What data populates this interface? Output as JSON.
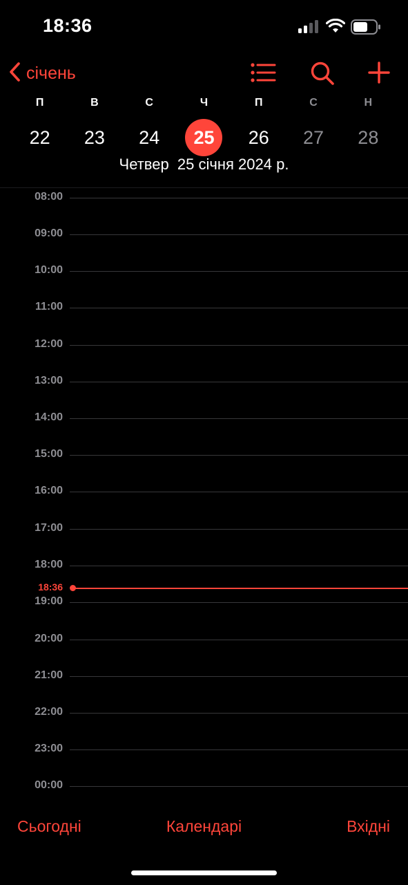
{
  "status_bar": {
    "time": "18:36",
    "icons": [
      "cellular-signal-icon",
      "wifi-icon",
      "battery-icon"
    ]
  },
  "nav": {
    "back_label": "січень",
    "icons": [
      "chevron-left-icon",
      "list-icon",
      "search-icon",
      "plus-icon"
    ],
    "accent_color": "#ff453a"
  },
  "week": {
    "days": [
      {
        "letter": "П",
        "date": "22",
        "weekend": false,
        "selected": false
      },
      {
        "letter": "В",
        "date": "23",
        "weekend": false,
        "selected": false
      },
      {
        "letter": "С",
        "date": "24",
        "weekend": false,
        "selected": false
      },
      {
        "letter": "Ч",
        "date": "25",
        "weekend": false,
        "selected": true
      },
      {
        "letter": "П",
        "date": "26",
        "weekend": false,
        "selected": false
      },
      {
        "letter": "С",
        "date": "27",
        "weekend": true,
        "selected": false
      },
      {
        "letter": "Н",
        "date": "28",
        "weekend": true,
        "selected": false
      }
    ],
    "date_caption": "Четвер  25 січня 2024 р."
  },
  "timeline": {
    "hours": [
      "08:00",
      "09:00",
      "10:00",
      "11:00",
      "12:00",
      "13:00",
      "14:00",
      "15:00",
      "16:00",
      "17:00",
      "18:00",
      "19:00",
      "20:00",
      "21:00",
      "22:00",
      "23:00",
      "00:00"
    ],
    "current_time_label": "18:36",
    "current_time_color": "#ff453a"
  },
  "toolbar": {
    "today_label": "Сьогодні",
    "calendars_label": "Календарі",
    "inbox_label": "Вхідні"
  }
}
